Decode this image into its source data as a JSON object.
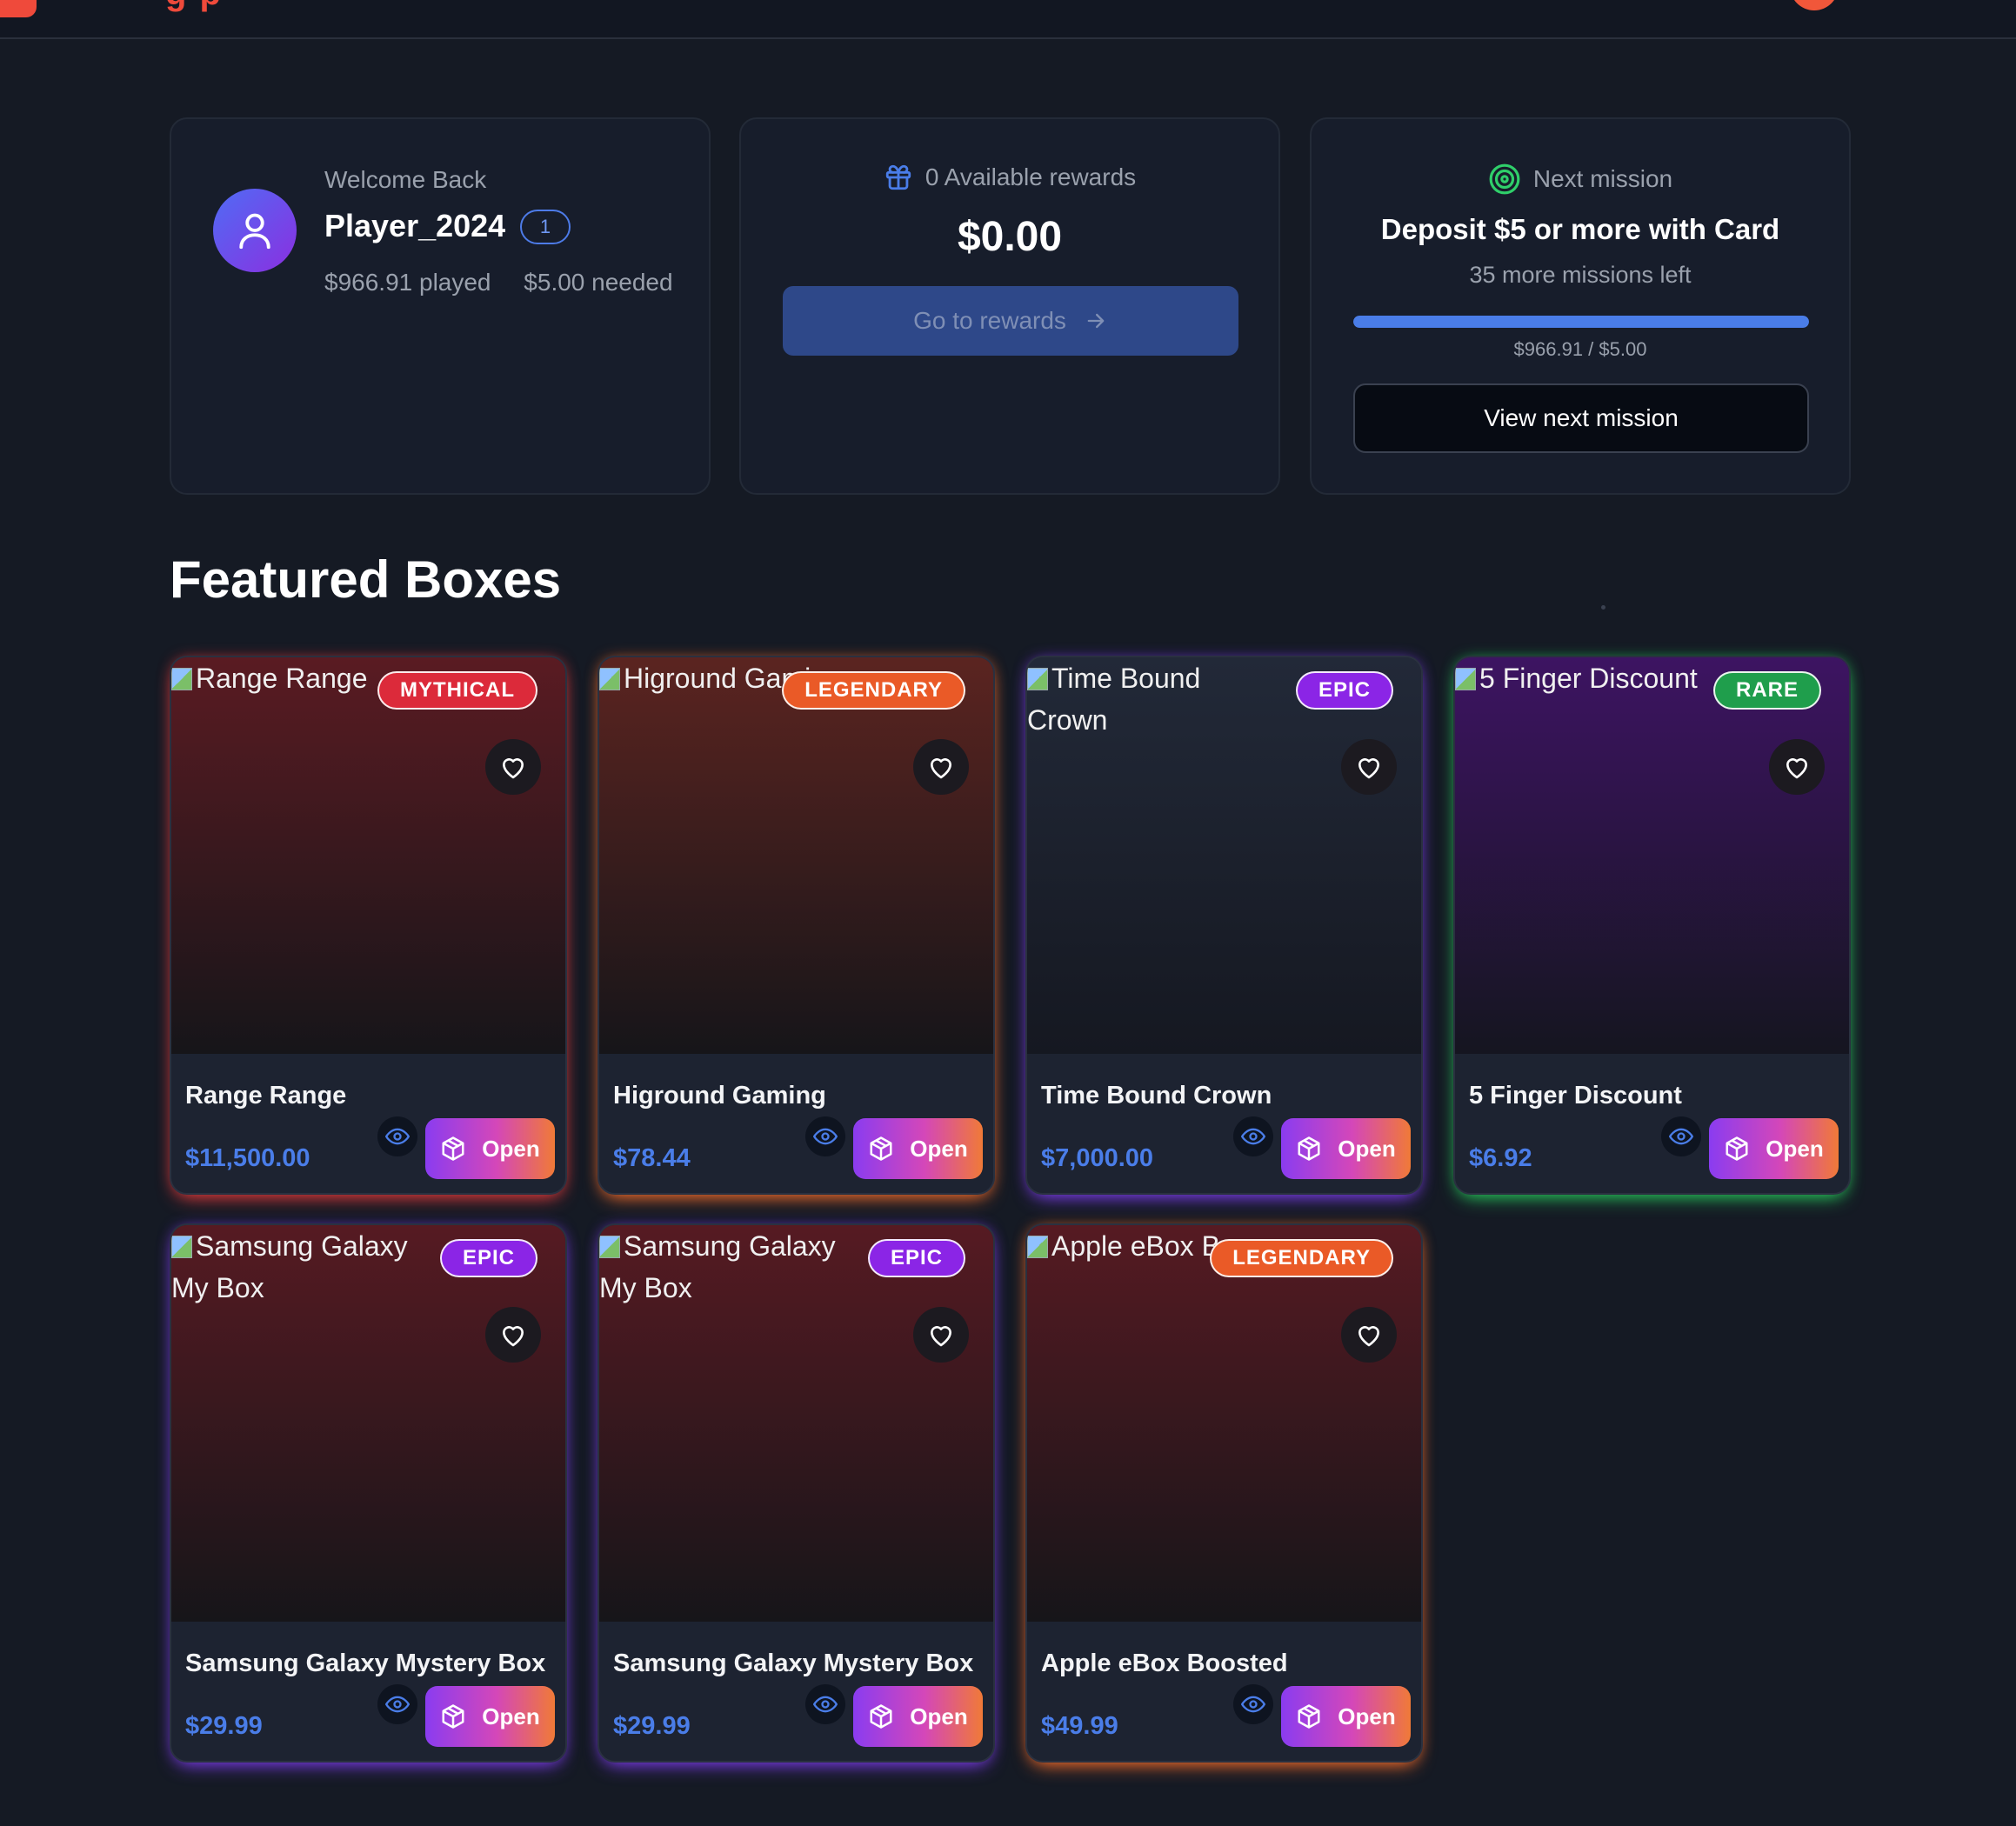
{
  "header": {
    "logo_letters": "g p"
  },
  "welcome": {
    "label": "Welcome Back",
    "username": "Player_2024",
    "level": "1",
    "played": "$966.91 played",
    "needed": "$5.00 needed"
  },
  "rewards": {
    "available": "0 Available rewards",
    "amount": "$0.00",
    "button": "Go to rewards"
  },
  "mission": {
    "label": "Next mission",
    "title": "Deposit $5 or more with Card",
    "remaining": "35 more missions left",
    "progress": 1.0,
    "progress_text": "$966.91 / $5.00",
    "button": "View next mission"
  },
  "featured": {
    "title": "Featured Boxes",
    "open_label": "Open",
    "boxes": [
      {
        "name": "Range Range",
        "alt": "Range Range",
        "price": "$11,500.00",
        "rarity": "MYTHICAL",
        "rarity_color": "#dc2a3a",
        "glow": "#e23a3a",
        "top": "#5a1b22",
        "bottom": "#161519"
      },
      {
        "name": "Higround Gaming",
        "alt": "Higround Gami",
        "price": "$78.44",
        "rarity": "LEGENDARY",
        "rarity_color": "#ea5a27",
        "glow": "#ef6a2a",
        "top": "#5b2420",
        "bottom": "#161519"
      },
      {
        "name": "Time Bound Crown",
        "alt": "Time Bound Crown",
        "price": "$7,000.00",
        "rarity": "EPIC",
        "rarity_color": "#8b25e6",
        "glow": "#7a3be6",
        "top": "#222938",
        "bottom": "#151821"
      },
      {
        "name": "5 Finger Discount",
        "alt": "5 Finger Discount",
        "price": "$6.92",
        "rarity": "RARE",
        "rarity_color": "#1f9e4c",
        "glow": "#27c55a",
        "top": "#3d1462",
        "bottom": "#151520"
      },
      {
        "name": "Samsung Galaxy Mystery Box",
        "alt": "Samsung Galaxy My Box",
        "price": "$29.99",
        "rarity": "EPIC",
        "rarity_color": "#8b25e6",
        "glow": "#7a3be6",
        "top": "#561a22",
        "bottom": "#161519"
      },
      {
        "name": "Samsung Galaxy Mystery Box",
        "alt": "Samsung Galaxy My Box",
        "price": "$29.99",
        "rarity": "EPIC",
        "rarity_color": "#8b25e6",
        "glow": "#7a3be6",
        "top": "#561a22",
        "bottom": "#161519"
      },
      {
        "name": "Apple eBox Boosted",
        "alt": "Apple eBox Bo",
        "price": "$49.99",
        "rarity": "LEGENDARY",
        "rarity_color": "#ea5a27",
        "glow": "#ef6a2a",
        "top": "#561a22",
        "bottom": "#161519"
      }
    ]
  },
  "icons": {
    "user": "user-icon",
    "gift": "gift-icon",
    "target": "target-icon",
    "arrow": "arrow-right-icon",
    "heart": "heart-icon",
    "eye": "eye-icon",
    "box": "box-icon"
  },
  "colors": {
    "accent_blue": "#4a7de8",
    "mission_green": "#2fcf6a",
    "brand_red": "#ef4a3b"
  }
}
